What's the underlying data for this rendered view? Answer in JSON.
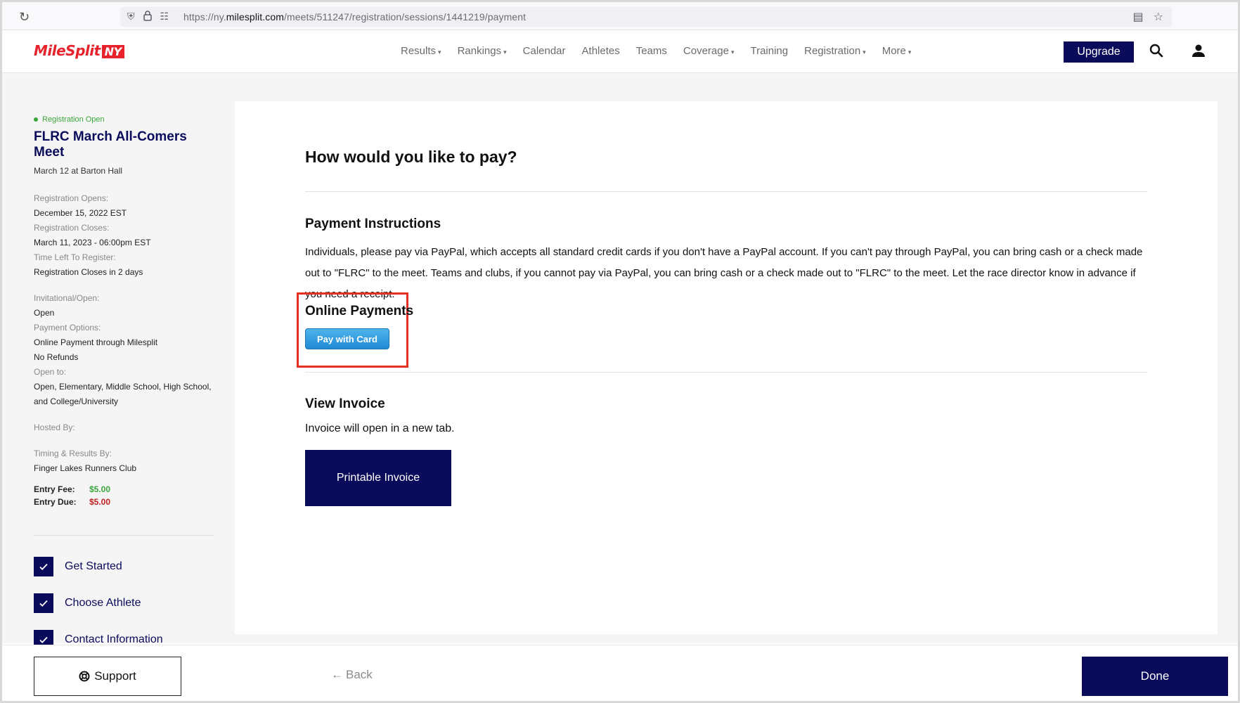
{
  "browser": {
    "url_prefix": "https://ny.",
    "url_domain": "milesplit.com",
    "url_path": "/meets/511247/registration/sessions/1441219/payment"
  },
  "header": {
    "logo_text": "MileSplit",
    "logo_region": "NY",
    "nav": [
      {
        "label": "Results",
        "dropdown": true
      },
      {
        "label": "Rankings",
        "dropdown": true
      },
      {
        "label": "Calendar",
        "dropdown": false
      },
      {
        "label": "Athletes",
        "dropdown": false
      },
      {
        "label": "Teams",
        "dropdown": false
      },
      {
        "label": "Coverage",
        "dropdown": true
      },
      {
        "label": "Training",
        "dropdown": false
      },
      {
        "label": "Registration",
        "dropdown": true
      },
      {
        "label": "More",
        "dropdown": true
      }
    ],
    "upgrade_label": "Upgrade"
  },
  "sidebar": {
    "status": "Registration Open",
    "meet_title": "FLRC March All-Comers Meet",
    "meet_date": "March 12 at Barton Hall",
    "reg_opens_label": "Registration Opens:",
    "reg_opens_value": "December 15, 2022 EST",
    "reg_closes_label": "Registration Closes:",
    "reg_closes_value": "March 11, 2023 - 06:00pm EST",
    "time_left_label": "Time Left To Register:",
    "time_left_value": "Registration Closes in 2 days",
    "invitational_label": "Invitational/Open:",
    "invitational_value": "Open",
    "payment_options_label": "Payment Options:",
    "payment_options_value1": "Online Payment through Milesplit",
    "payment_options_value2": "No Refunds",
    "open_to_label": "Open to:",
    "open_to_value1": "Open, Elementary, Middle School, High School,",
    "open_to_value2": "and College/University",
    "hosted_by_label": "Hosted By:",
    "timing_label": "Timing & Results By:",
    "timing_value": "Finger Lakes Runners Club",
    "entry_fee_label": "Entry Fee:",
    "entry_fee_value": "$5.00",
    "entry_due_label": "Entry Due:",
    "entry_due_value": "$5.00",
    "steps": [
      {
        "label": "Get Started"
      },
      {
        "label": "Choose Athlete"
      },
      {
        "label": "Contact Information"
      }
    ]
  },
  "main": {
    "heading": "How would you like to pay?",
    "payment_instructions_title": "Payment Instructions",
    "payment_instructions_text": "Individuals, please pay via PayPal, which accepts all standard credit cards if you don't have a PayPal account. If you can't pay through PayPal, you can bring cash or a check made out to \"FLRC\" to the meet. Teams and clubs, if you cannot pay via PayPal, you can bring cash or a check made out to \"FLRC\" to the meet. Let the race director know in advance if you need a receipt.",
    "online_payments_title": "Online Payments",
    "pay_with_card_label": "Pay with Card",
    "view_invoice_title": "View Invoice",
    "view_invoice_text": "Invoice will open in a new tab.",
    "printable_invoice_label": "Printable Invoice"
  },
  "footer": {
    "support_label": "Support",
    "back_label": "Back",
    "done_label": "Done"
  },
  "colors": {
    "brand_navy": "#0b0b5c",
    "brand_red": "#e8222b",
    "status_green": "#3aa63a",
    "highlight_red": "#e5301f",
    "pay_button_blue": "#1f8ad5"
  }
}
